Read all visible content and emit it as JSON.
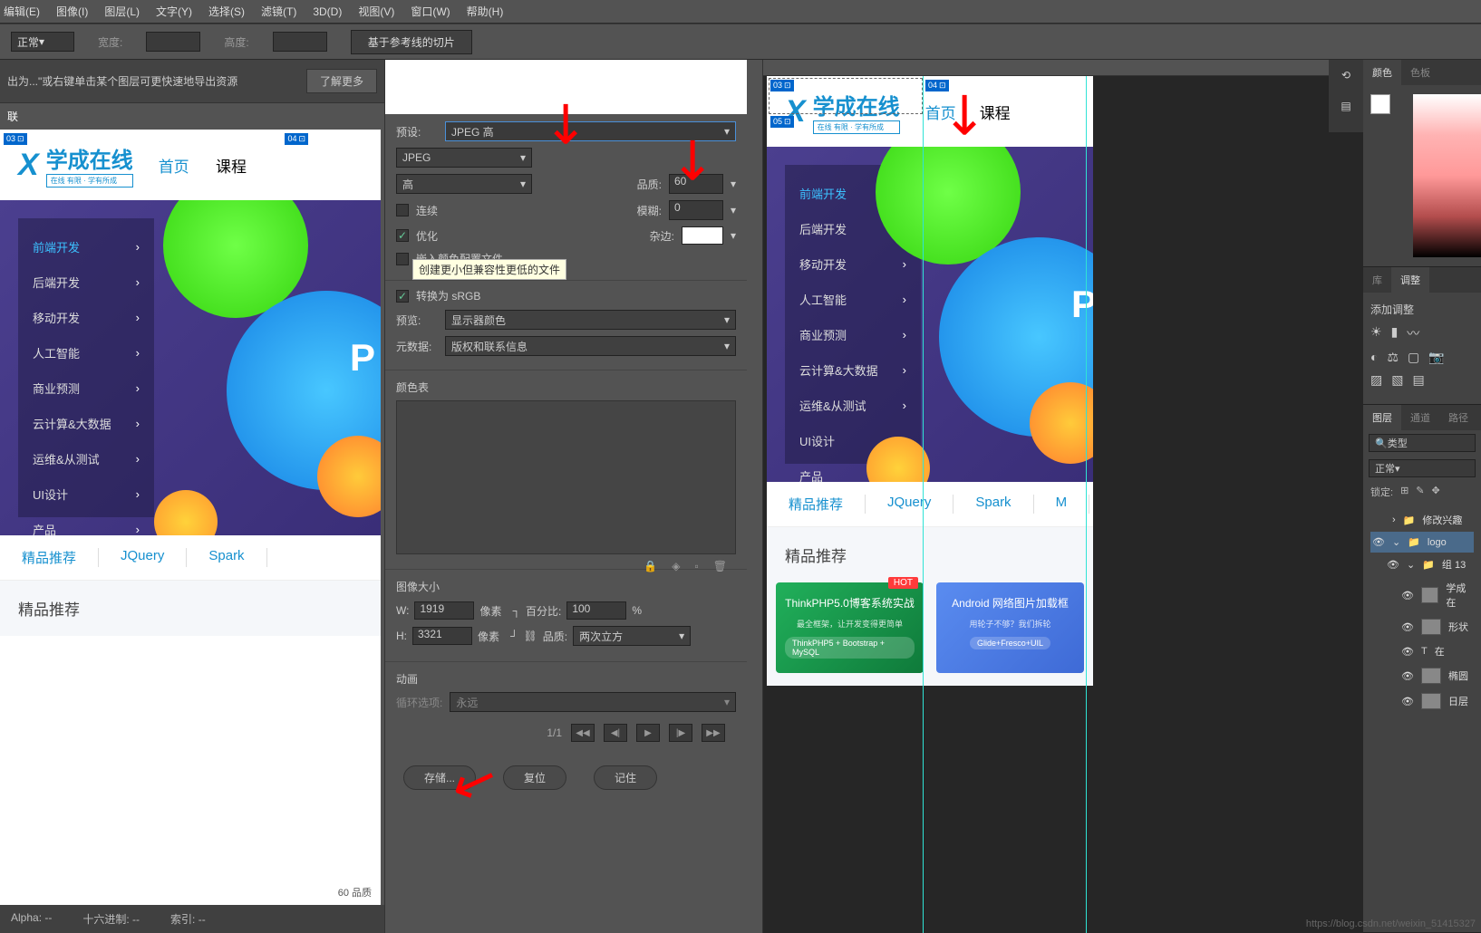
{
  "menu": [
    "编辑(E)",
    "图像(I)",
    "图层(L)",
    "文字(Y)",
    "选择(S)",
    "滤镜(T)",
    "3D(D)",
    "视图(V)",
    "窗口(W)",
    "帮助(H)"
  ],
  "optbar": {
    "mode": "正常",
    "width_label": "宽度:",
    "height_label": "高度:",
    "slice_btn": "基于参考线的切片"
  },
  "tip": {
    "text": "出为...\"或右键单击某个图层可更快速地导出资源",
    "learn": "了解更多"
  },
  "lefttab": "联",
  "sfw": {
    "preset_label": "预设:",
    "preset": "JPEG 高",
    "format": "JPEG",
    "quality_preset": "高",
    "quality_label": "品质:",
    "quality": "60",
    "progressive": "连续",
    "blur_label": "模糊:",
    "blur": "0",
    "optimized": "优化",
    "matte_label": "杂边:",
    "embed": "嵌入颜色配置文件",
    "tooltip": "创建更小但兼容性更低的文件",
    "srgb": "转换为 sRGB",
    "preview_label": "预览:",
    "preview": "显示器颜色",
    "meta_label": "元数据:",
    "meta": "版权和联系信息",
    "colortable": "颜色表",
    "imgsize": "图像大小",
    "w": "W:",
    "w_val": "1919",
    "h": "H:",
    "h_val": "3321",
    "px": "像素",
    "pct_label": "百分比:",
    "pct": "100",
    "pct_unit": "%",
    "res_label": "品质:",
    "resample": "两次立方",
    "anim": "动画",
    "loop_label": "循环选项:",
    "loop": "永远",
    "page": "1/1",
    "save_btn": "存储...",
    "reset_btn": "复位",
    "remember_btn": "记住"
  },
  "status": {
    "alpha": "Alpha: --",
    "hex": "十六进制: --",
    "idx": "索引: --",
    "quality": "60 品质"
  },
  "site": {
    "logo": "学成在线",
    "logo_sub": "在线 有限 · 学有所成",
    "nav": [
      "首页",
      "课程"
    ],
    "side": [
      "前端开发",
      "后端开发",
      "移动开发",
      "人工智能",
      "商业预测",
      "云计算&大数据",
      "运维&从测试",
      "UI设计",
      "产品"
    ],
    "P": "P",
    "tabs": [
      "精品推荐",
      "JQuery",
      "Spark",
      "M"
    ],
    "section": "精品推荐",
    "card1_title": "ThinkPHP5.0博客系统实战",
    "card1_sub": "最全框架，让开发变得更简单",
    "card1_pill": "ThinkPHP5 + Bootstrap + MySQL",
    "card2_title": "Android 网络图片加载框",
    "card2_sub": "用轮子不够？我们拆轮",
    "card2_pill": "Glide+Fresco+UIL",
    "hot": "HOT"
  },
  "slices": [
    "03",
    "04",
    "05"
  ],
  "panels": {
    "color": "颜色",
    "swatch": "色板",
    "lib": "库",
    "adjust": "调整",
    "add_adjust": "添加调整",
    "layers": "图层",
    "channels": "通道",
    "paths": "路径",
    "type_filter": "类型",
    "blend": "正常",
    "lock": "锁定:",
    "layer_items": [
      "修改兴趣",
      "logo",
      "组 13",
      "学成在",
      "形状",
      "在",
      "椭圆",
      "日层"
    ]
  },
  "watermark": "https://blog.csdn.net/weixin_51415327"
}
